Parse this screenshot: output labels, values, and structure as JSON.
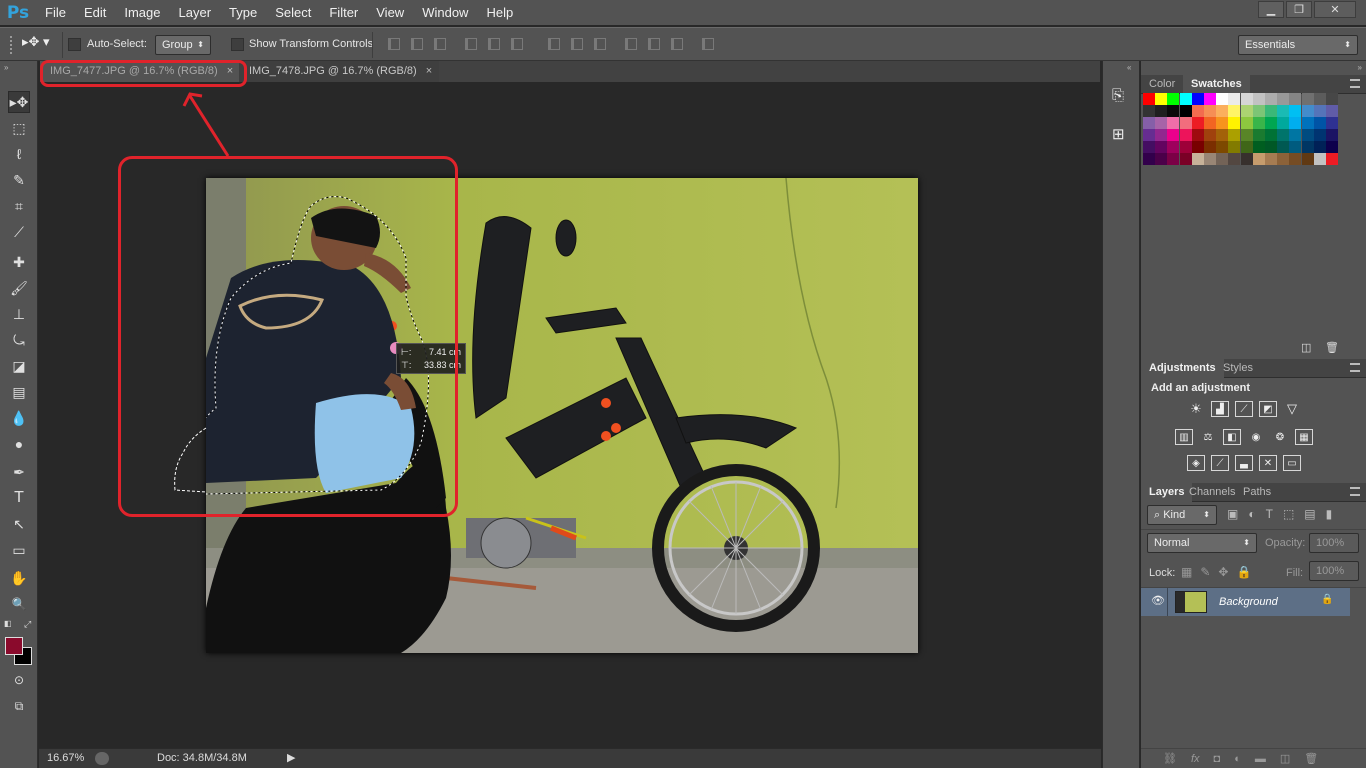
{
  "app": {
    "logo": "Ps"
  },
  "menu": {
    "items": [
      "File",
      "Edit",
      "Image",
      "Layer",
      "Type",
      "Select",
      "Filter",
      "View",
      "Window",
      "Help"
    ]
  },
  "window_controls": {
    "minimize": "▁",
    "restore": "❐",
    "close": "✕"
  },
  "options": {
    "auto_select_label": "Auto-Select:",
    "auto_select_value": "Group",
    "show_transform_label": "Show Transform Controls",
    "workspace": "Essentials"
  },
  "tabs": [
    {
      "label": "IMG_7477.JPG @ 16.7% (RGB/8)",
      "close": "×"
    },
    {
      "label": "IMG_7478.JPG @ 16.7% (RGB/8)",
      "close": "×"
    }
  ],
  "tools": [
    "move-icon",
    "marquee-icon",
    "lasso-icon",
    "quick-select-icon",
    "crop-icon",
    "eyedropper-icon",
    "healing-brush-icon",
    "brush-icon",
    "clone-stamp-icon",
    "history-brush-icon",
    "eraser-icon",
    "gradient-icon",
    "blur-icon",
    "dodge-icon",
    "pen-icon",
    "type-icon",
    "path-select-icon",
    "rectangle-icon",
    "hand-icon",
    "zoom-icon"
  ],
  "tool_glyphs": [
    "▸✥",
    "⬚",
    "ℓ",
    "✎",
    "⌗",
    "⟋",
    "✚",
    "🖌",
    "⊥",
    "⤿",
    "◪",
    "▤",
    "💧",
    "●",
    "✒",
    "T",
    "↖",
    "▭",
    "✋",
    "🔍"
  ],
  "colors": {
    "foreground": "#8a0a2c",
    "background": "#000000",
    "accent_red": "#e0232b"
  },
  "measure_tooltip": {
    "w_label": "⊢:",
    "w_value": "7.41 cm",
    "h_label": "⊤:",
    "h_value": "33.83 cm"
  },
  "status": {
    "zoom": "16.67%",
    "doc": "Doc: 34.8M/34.8M"
  },
  "color_panel": {
    "tabs": [
      "Color",
      "Swatches"
    ],
    "active": "Swatches"
  },
  "swatches": [
    [
      "#ff0000",
      "#ffff00",
      "#00ff00",
      "#00ffff",
      "#0000ff",
      "#ff00ff",
      "#ffffff",
      "#ebebeb",
      "#d6d6d6",
      "#c2c2c2",
      "#adadad",
      "#999999",
      "#858585",
      "#707070",
      "#5c5c5c",
      "#474747"
    ],
    [
      "#333333",
      "#1f1f1f",
      "#0a0a0a",
      "#000000",
      "#f26c4f",
      "#f68e55",
      "#fbaf5d",
      "#fff467",
      "#acd372",
      "#7cc576",
      "#3bb878",
      "#1abbb4",
      "#00bff3",
      "#438ccb",
      "#5574b9",
      "#605ca8"
    ],
    [
      "#855fa8",
      "#a763a8",
      "#f06ea9",
      "#f26d7d",
      "#ed1c24",
      "#f26522",
      "#f7941d",
      "#fff200",
      "#8dc73f",
      "#39b54a",
      "#00a651",
      "#00a99d",
      "#00aeef",
      "#0072bc",
      "#0054a6",
      "#2e3192"
    ],
    [
      "#662d91",
      "#92278f",
      "#ec008c",
      "#ed145b",
      "#9e0b0f",
      "#a0410d",
      "#a36209",
      "#aba000",
      "#598527",
      "#1a7b30",
      "#007236",
      "#00746b",
      "#0076a3",
      "#004b80",
      "#003471",
      "#1b1464"
    ],
    [
      "#440e62",
      "#630460",
      "#9e005d",
      "#9e0039",
      "#790000",
      "#7b2e00",
      "#7d4900",
      "#827b00",
      "#406618",
      "#005e20",
      "#005826",
      "#005952",
      "#005b7f",
      "#003663",
      "#002157",
      "#0d004c"
    ],
    [
      "#32004b",
      "#4b0049",
      "#7b0046",
      "#7a0026",
      "#c7b299",
      "#998675",
      "#736357",
      "#534741",
      "#37302d",
      "#c69c6d",
      "#a67c52",
      "#8c6239",
      "#754c24",
      "#603913",
      "#c2c2c2",
      "#ed1c24"
    ]
  ],
  "adjustments": {
    "tabs": [
      "Adjustments",
      "Styles"
    ],
    "title": "Add an adjustment"
  },
  "layers": {
    "tabs": [
      "Layers",
      "Channels",
      "Paths"
    ],
    "kind": "Kind",
    "blend_mode": "Normal",
    "opacity_label": "Opacity:",
    "opacity_value": "100%",
    "lock_label": "Lock:",
    "fill_label": "Fill:",
    "fill_value": "100%",
    "items": [
      {
        "name": "Background",
        "visible_icon": "👁",
        "lock_icon": "🔒"
      }
    ]
  }
}
